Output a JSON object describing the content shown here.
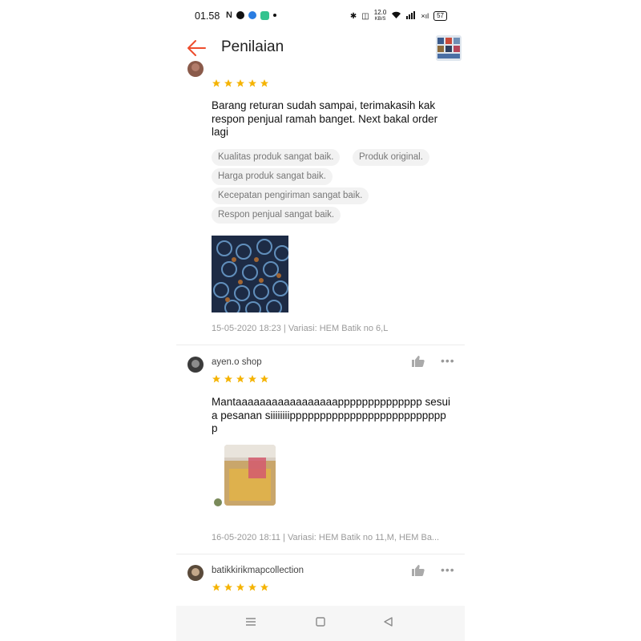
{
  "status_bar": {
    "time": "01.58",
    "left_icons": [
      "n-icon",
      "facebook-icon",
      "messenger-icon",
      "app-icon",
      "dot-icon"
    ],
    "speed": "12.0",
    "speed_unit": "KB/S",
    "battery": "57"
  },
  "app_bar": {
    "title": "Penilaian"
  },
  "reviews": [
    {
      "rating": 5,
      "text": "Barang returan sudah sampai, terimakasih kak respon penjual ramah banget. Next bakal order lagi",
      "tags": [
        "Kualitas produk sangat baik.",
        "Produk original.",
        "Harga produk sangat baik.",
        "Kecepatan pengiriman sangat baik.",
        "Respon penjual sangat baik."
      ],
      "meta": "15-05-2020 18:23 | Variasi: HEM Batik no 6,L"
    },
    {
      "username": "ayen.o shop",
      "rating": 5,
      "text": "Mantaaaaaaaaaaaaaaaaapppppppppppppp sesuia pesanan siiiiiiiippppppppppppppppppppppppppp",
      "meta": "16-05-2020 18:11 | Variasi: HEM Batik no 11,M, HEM Ba..."
    },
    {
      "username": "batikkirikmapcollection",
      "rating": 5
    }
  ],
  "colors": {
    "accent": "#ee4d2d",
    "star": "#f5b301"
  }
}
